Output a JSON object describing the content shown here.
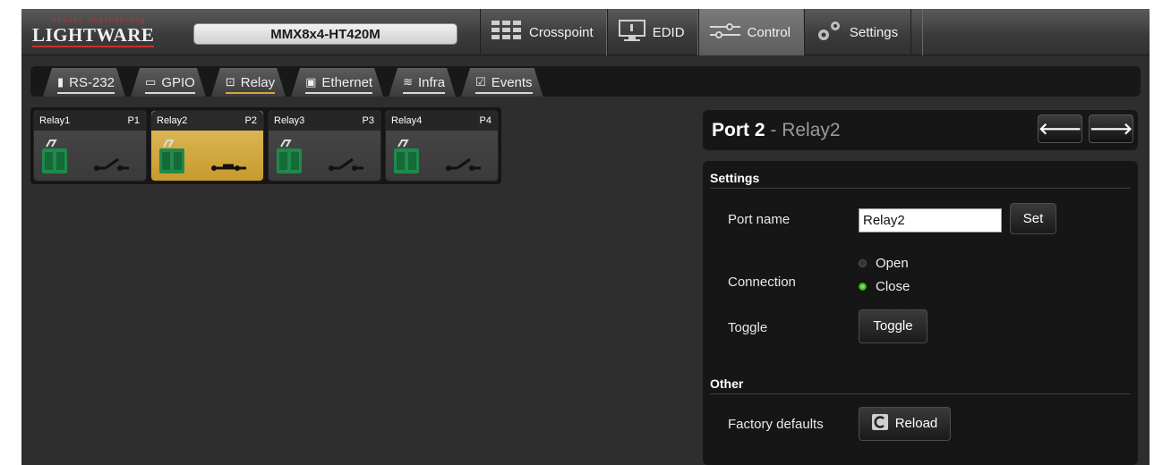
{
  "brand": {
    "tagline": "visual engineering",
    "name": "LIGHTWARE"
  },
  "device_name": "MMX8x4-HT420M",
  "main_nav": [
    {
      "label": "Crosspoint",
      "icon": "grid-icon"
    },
    {
      "label": "EDID",
      "icon": "monitor-icon"
    },
    {
      "label": "Control",
      "icon": "sliders-icon",
      "active": true
    },
    {
      "label": "Settings",
      "icon": "gears-icon"
    }
  ],
  "sub_tabs": [
    {
      "label": "RS-232",
      "icon": "serial-icon"
    },
    {
      "label": "GPIO",
      "icon": "gpio-icon"
    },
    {
      "label": "Relay",
      "icon": "relay-icon",
      "active": true
    },
    {
      "label": "Ethernet",
      "icon": "ethernet-icon"
    },
    {
      "label": "Infra",
      "icon": "wifi-icon"
    },
    {
      "label": "Events",
      "icon": "events-icon"
    }
  ],
  "relays": [
    {
      "name": "Relay1",
      "port": "P1",
      "selected": false
    },
    {
      "name": "Relay2",
      "port": "P2",
      "selected": true
    },
    {
      "name": "Relay3",
      "port": "P3",
      "selected": false
    },
    {
      "name": "Relay4",
      "port": "P4",
      "selected": false
    }
  ],
  "port_panel": {
    "title": "Port 2",
    "separator": " - ",
    "subtitle": "Relay2",
    "prev_glyph": "🡐",
    "next_glyph": "🡒"
  },
  "settings": {
    "title": "Settings",
    "port_name_label": "Port name",
    "port_name_value": "Relay2",
    "set_label": "Set",
    "connection_label": "Connection",
    "connection_options": [
      "Open",
      "Close"
    ],
    "connection_selected": "Close",
    "toggle_label": "Toggle",
    "toggle_button": "Toggle"
  },
  "other": {
    "title": "Other",
    "factory_defaults_label": "Factory defaults",
    "reload_button": "Reload"
  },
  "colors": {
    "accent": "#d6a642",
    "selected_tile": "#d9b24a",
    "connector": "#1f8a4c",
    "radio_on": "#4ed82a"
  }
}
